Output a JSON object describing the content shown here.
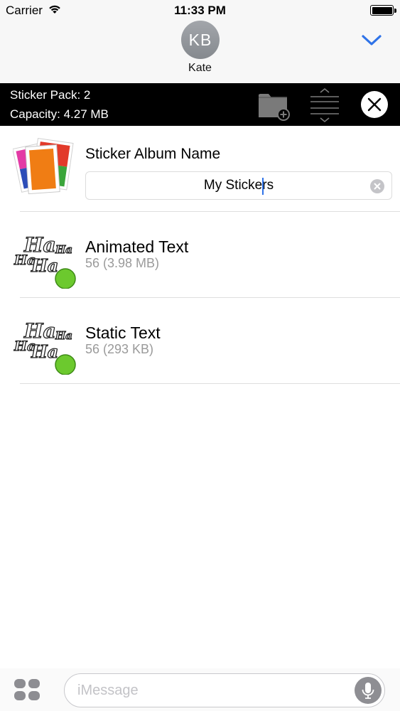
{
  "status_bar": {
    "carrier": "Carrier",
    "time": "11:33 PM"
  },
  "header": {
    "avatar_initials": "KB",
    "contact_name": "Kate"
  },
  "pack_bar": {
    "sticker_pack": "Sticker Pack: 2",
    "capacity": "Capacity: 4.27 MB"
  },
  "album": {
    "label": "Sticker Album Name",
    "name_value": "My Stickers"
  },
  "stickers": [
    {
      "name": "Animated Text",
      "meta": "56 (3.98 MB)",
      "icon": "haha-sticker-icon"
    },
    {
      "name": "Static Text",
      "meta": "56 (293 KB)",
      "icon": "haha-sticker-icon"
    }
  ],
  "composer": {
    "placeholder": "iMessage"
  },
  "colors": {
    "accent": "#2f73e8",
    "status_dot": "#6cc92e",
    "pack_bar_bg": "#000000"
  }
}
